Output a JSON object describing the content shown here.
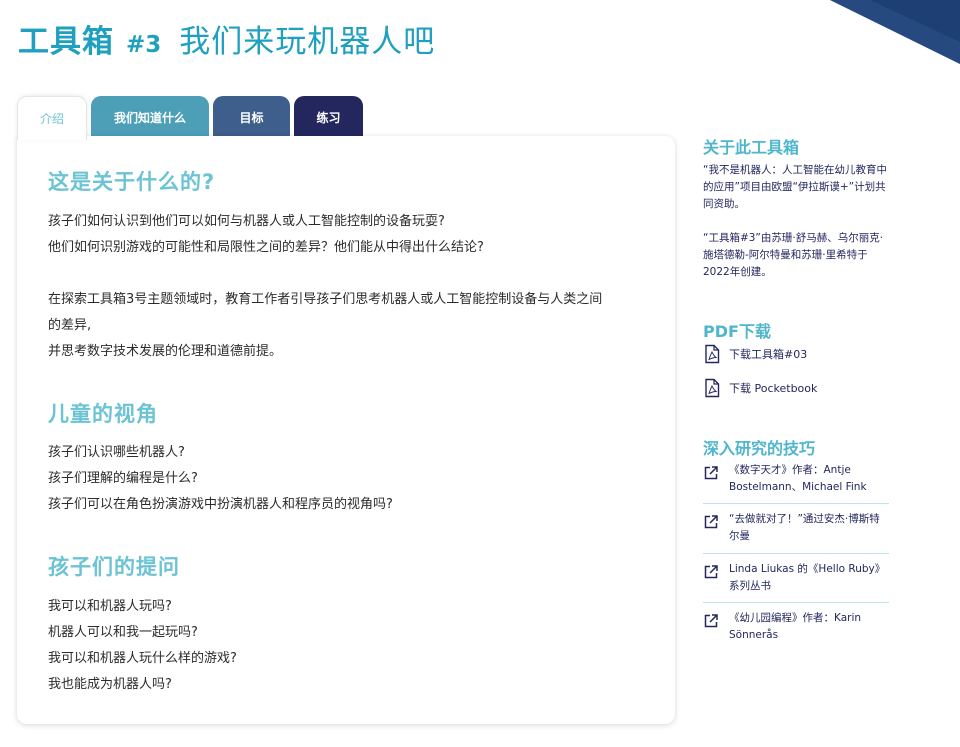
{
  "header": {
    "title_main": "工具箱",
    "title_num": "#3",
    "title_sub": "我们来玩机器人吧"
  },
  "tabs": [
    {
      "label": "介绍",
      "active": true
    },
    {
      "label": "我们知道什么"
    },
    {
      "label": "目标"
    },
    {
      "label": "练习"
    }
  ],
  "content": {
    "section1": {
      "heading": "这是关于什么的?",
      "lines_a": [
        "孩子们如何认识到他们可以如何与机器人或人工智能控制的设备玩耍?",
        "他们如何识别游戏的可能性和局限性之间的差异？他们能从中得出什么结论?"
      ],
      "lines_b": [
        "在探索工具箱3号主题领域时，教育工作者引导孩子们思考机器人或人工智能控制设备与人类之间",
        "的差异,",
        "并思考数字技术发展的伦理和道德前提。"
      ]
    },
    "section2": {
      "heading": "儿童的视角",
      "lines": [
        "孩子们认识哪些机器人?",
        "孩子们理解的编程是什么?",
        "孩子们可以在角色扮演游戏中扮演机器人和程序员的视角吗?"
      ]
    },
    "section3": {
      "heading": "孩子们的提问",
      "lines": [
        "我可以和机器人玩吗?",
        "机器人可以和我一起玩吗?",
        "我可以和机器人玩什么样的游戏?",
        "我也能成为机器人吗?"
      ]
    }
  },
  "sidebar": {
    "about": {
      "heading": "关于此工具箱",
      "p1": "“我不是机器人：人工智能在幼儿教育中的应用”项目由欧盟“伊拉斯谟+”计划共同资助。",
      "p2": "“工具箱#3”由苏珊·舒马赫、乌尔丽克·施塔德勒-阿尔特曼和苏珊·里希特于2022年创建。"
    },
    "downloads": {
      "heading": "PDF下载",
      "items": [
        "下载工具箱#03",
        "下载 Pocketbook"
      ]
    },
    "tips": {
      "heading": "深入研究的技巧",
      "items": [
        "《数字天才》作者：Antje Bostelmann、Michael Fink",
        "“去做就对了！”通过安杰·博斯特尔曼",
        "Linda Liukas 的《Hello Ruby》系列丛书",
        "《幼儿园编程》作者：Karin Sönnerås"
      ]
    }
  },
  "colors": {
    "title": "#1fa0bf",
    "heading": "#6cc3d3",
    "tab_2": "#4c9fb7",
    "tab_3": "#3e5e8b",
    "tab_4": "#23275e",
    "sidebar_text": "#23275e"
  },
  "icons": {
    "download": "pdf-file-icon",
    "tip": "external-link-icon"
  }
}
